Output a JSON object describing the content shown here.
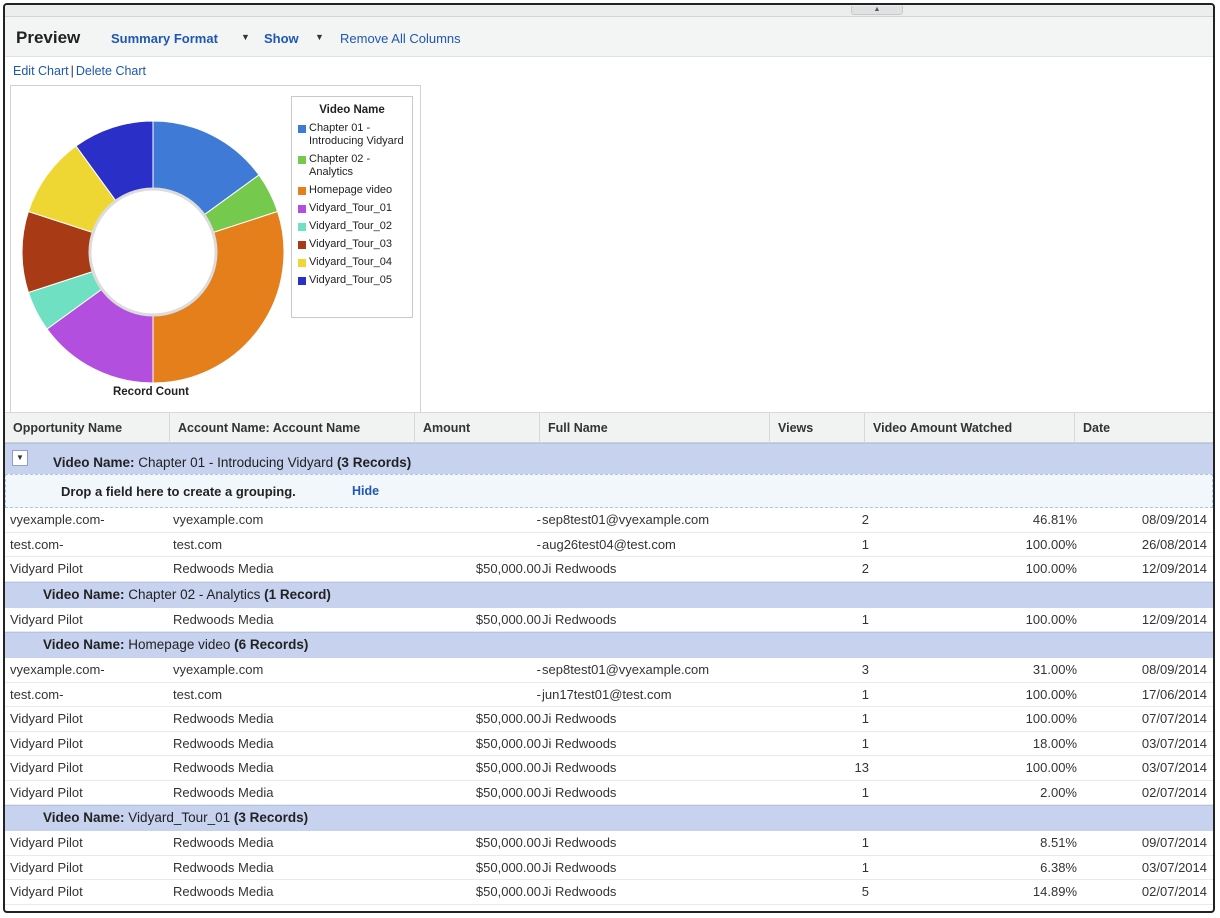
{
  "toolbar": {
    "title": "Preview",
    "summary_format": "Summary Format",
    "show": "Show",
    "remove_columns": "Remove All Columns"
  },
  "chart_links": {
    "edit": "Edit Chart",
    "delete": "Delete Chart",
    "separator": "|"
  },
  "chart_data": {
    "type": "pie",
    "legend_title": "Video Name",
    "caption": "Record Count",
    "legend_position": "right",
    "slices": [
      {
        "label": "Chapter 01 - Introducing Vidyard",
        "value": 3,
        "color": "#3f7bd6"
      },
      {
        "label": "Chapter 02 - Analytics",
        "value": 1,
        "color": "#75c94d"
      },
      {
        "label": "Homepage video",
        "value": 6,
        "color": "#e47f1c"
      },
      {
        "label": "Vidyard_Tour_01",
        "value": 3,
        "color": "#b24fdf"
      },
      {
        "label": "Vidyard_Tour_02",
        "value": 1,
        "color": "#6fe0c1"
      },
      {
        "label": "Vidyard_Tour_03",
        "value": 2,
        "color": "#a83a16"
      },
      {
        "label": "Vidyard_Tour_04",
        "value": 2,
        "color": "#efd733"
      },
      {
        "label": "Vidyard_Tour_05",
        "value": 2,
        "color": "#2a2fc7"
      }
    ]
  },
  "table": {
    "columns": [
      "Opportunity Name",
      "Account Name: Account Name",
      "Amount",
      "Full Name",
      "Views",
      "Video Amount Watched",
      "Date"
    ],
    "group_key": "Video Name:",
    "drop_zone": {
      "message": "Drop a field here to create a grouping.",
      "hide": "Hide"
    },
    "groups": [
      {
        "name": "Chapter 01 - Introducing Vidyard",
        "count": "(3 Records)",
        "rows": [
          [
            "vyexample.com-",
            "vyexample.com",
            "-",
            "sep8test01@vyexample.com",
            "2",
            "46.81%",
            "08/09/2014"
          ],
          [
            "test.com-",
            "test.com",
            "-",
            "aug26test04@test.com",
            "1",
            "100.00%",
            "26/08/2014"
          ],
          [
            "Vidyard Pilot",
            "Redwoods Media",
            "$50,000.00",
            "Ji Redwoods",
            "2",
            "100.00%",
            "12/09/2014"
          ]
        ]
      },
      {
        "name": "Chapter 02 - Analytics",
        "count": "(1 Record)",
        "rows": [
          [
            "Vidyard Pilot",
            "Redwoods Media",
            "$50,000.00",
            "Ji Redwoods",
            "1",
            "100.00%",
            "12/09/2014"
          ]
        ]
      },
      {
        "name": "Homepage video",
        "count": "(6 Records)",
        "rows": [
          [
            "vyexample.com-",
            "vyexample.com",
            "-",
            "sep8test01@vyexample.com",
            "3",
            "31.00%",
            "08/09/2014"
          ],
          [
            "test.com-",
            "test.com",
            "-",
            "jun17test01@test.com",
            "1",
            "100.00%",
            "17/06/2014"
          ],
          [
            "Vidyard Pilot",
            "Redwoods Media",
            "$50,000.00",
            "Ji Redwoods",
            "1",
            "100.00%",
            "07/07/2014"
          ],
          [
            "Vidyard Pilot",
            "Redwoods Media",
            "$50,000.00",
            "Ji Redwoods",
            "1",
            "18.00%",
            "03/07/2014"
          ],
          [
            "Vidyard Pilot",
            "Redwoods Media",
            "$50,000.00",
            "Ji Redwoods",
            "13",
            "100.00%",
            "03/07/2014"
          ],
          [
            "Vidyard Pilot",
            "Redwoods Media",
            "$50,000.00",
            "Ji Redwoods",
            "1",
            "2.00%",
            "02/07/2014"
          ]
        ]
      },
      {
        "name": "Vidyard_Tour_01",
        "count": "(3 Records)",
        "rows": [
          [
            "Vidyard Pilot",
            "Redwoods Media",
            "$50,000.00",
            "Ji Redwoods",
            "1",
            "8.51%",
            "09/07/2014"
          ],
          [
            "Vidyard Pilot",
            "Redwoods Media",
            "$50,000.00",
            "Ji Redwoods",
            "1",
            "6.38%",
            "03/07/2014"
          ],
          [
            "Vidyard Pilot",
            "Redwoods Media",
            "$50,000.00",
            "Ji Redwoods",
            "5",
            "14.89%",
            "02/07/2014"
          ]
        ]
      }
    ]
  }
}
